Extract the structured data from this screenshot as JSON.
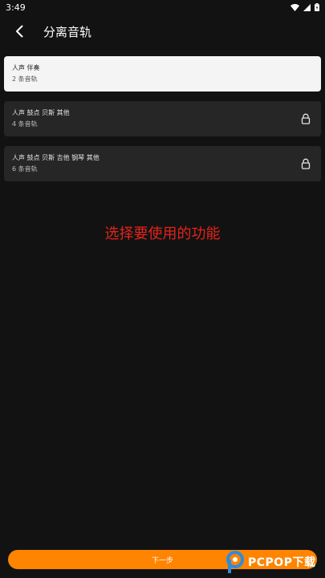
{
  "status_bar": {
    "time": "3:49",
    "icons": [
      "wifi-icon",
      "cellular-icon",
      "battery-icon"
    ]
  },
  "app_bar": {
    "back_icon": "back-arrow-icon",
    "title": "分离音轨"
  },
  "options": [
    {
      "title": "人声 伴奏",
      "subtitle": "2 条音轨",
      "selected": true,
      "locked": false
    },
    {
      "title": "人声 鼓点 贝斯 其他",
      "subtitle": "4 条音轨",
      "selected": false,
      "locked": true
    },
    {
      "title": "人声 鼓点 贝斯 吉他 钢琴 其他",
      "subtitle": "6 条音轨",
      "selected": false,
      "locked": true
    }
  ],
  "hint": "选择要使用的功能",
  "next_button": {
    "label": "下一步"
  },
  "watermark": {
    "text": "PCPOP下载"
  },
  "colors": {
    "background": "#121212",
    "card": "#262626",
    "card_selected": "#f4f4f4",
    "accent": "#ff8400",
    "hint": "#e3231b"
  }
}
